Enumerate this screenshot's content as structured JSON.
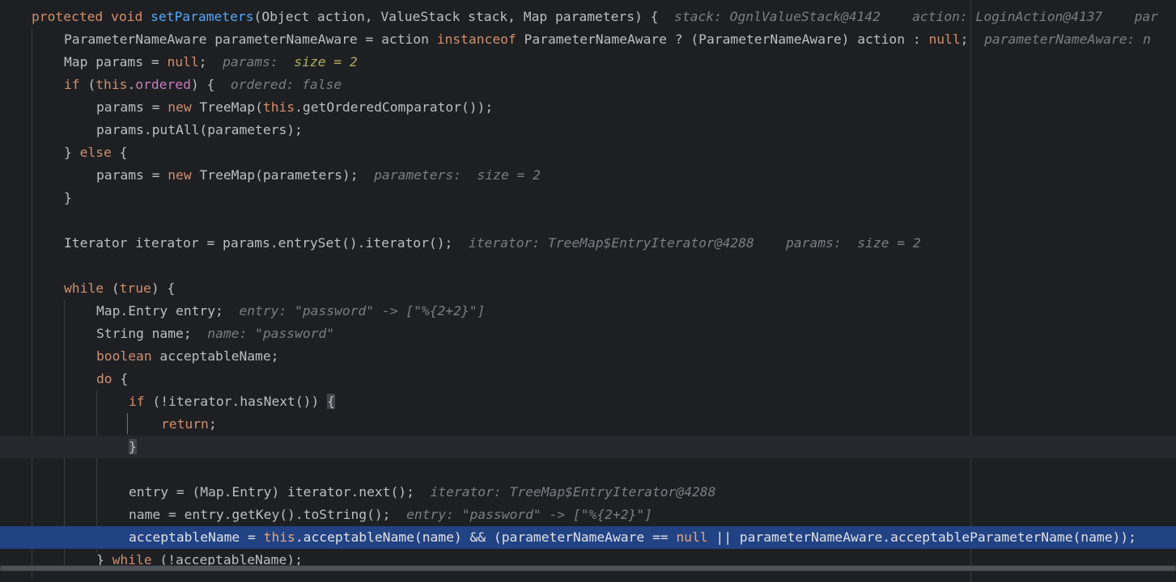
{
  "editor": {
    "lines": [
      [
        {
          "t": "protected",
          "c": "kw"
        },
        {
          "t": " "
        },
        {
          "t": "void",
          "c": "kw"
        },
        {
          "t": " "
        },
        {
          "t": "setParameters",
          "c": "fn"
        },
        {
          "t": "(Object action, ValueStack stack, Map parameters) {"
        },
        {
          "t": "  stack: OgnlValueStack@4142    action: LoginAction@4137    par",
          "c": "hint"
        }
      ],
      [
        {
          "t": "ParameterNameAware parameterNameAware = action "
        },
        {
          "t": "instanceof",
          "c": "kw"
        },
        {
          "t": " ParameterNameAware ? (ParameterNameAware) action : "
        },
        {
          "t": "null",
          "c": "kw"
        },
        {
          "t": ";"
        },
        {
          "t": "  parameterNameAware: n",
          "c": "hint"
        }
      ],
      [
        {
          "t": "Map params = "
        },
        {
          "t": "null",
          "c": "kw"
        },
        {
          "t": ";"
        },
        {
          "t": "  params:  ",
          "c": "hint"
        },
        {
          "t": "size = 2",
          "c": "hint-val"
        }
      ],
      [
        {
          "t": "if",
          "c": "kw"
        },
        {
          "t": " ("
        },
        {
          "t": "this",
          "c": "kw"
        },
        {
          "t": "."
        },
        {
          "t": "ordered",
          "c": "field"
        },
        {
          "t": ") {"
        },
        {
          "t": "  ordered: false",
          "c": "hint"
        }
      ],
      [
        {
          "t": "params = "
        },
        {
          "t": "new",
          "c": "kw"
        },
        {
          "t": " TreeMap("
        },
        {
          "t": "this",
          "c": "kw"
        },
        {
          "t": ".getOrderedComparator());"
        }
      ],
      [
        {
          "t": "params.putAll(parameters);"
        }
      ],
      [
        {
          "t": "} "
        },
        {
          "t": "else",
          "c": "kw"
        },
        {
          "t": " {"
        }
      ],
      [
        {
          "t": "params = "
        },
        {
          "t": "new",
          "c": "kw"
        },
        {
          "t": " TreeMap(parameters);"
        },
        {
          "t": "  parameters:  size = 2",
          "c": "hint"
        }
      ],
      [
        {
          "t": "}"
        }
      ],
      [],
      [
        {
          "t": "Iterator iterator = params.entrySet().iterator();"
        },
        {
          "t": "  iterator: TreeMap$EntryIterator@4288    params:  size = 2",
          "c": "hint"
        }
      ],
      [],
      [
        {
          "t": "while",
          "c": "kw"
        },
        {
          "t": " ("
        },
        {
          "t": "true",
          "c": "kw"
        },
        {
          "t": ") {"
        }
      ],
      [
        {
          "t": "Map.Entry entry;"
        },
        {
          "t": "  entry: \"password\" -> [\"%{2+2}\"]",
          "c": "hint"
        }
      ],
      [
        {
          "t": "String name;"
        },
        {
          "t": "  name: \"password\"",
          "c": "hint"
        }
      ],
      [
        {
          "t": "boolean",
          "c": "kw"
        },
        {
          "t": " acceptableName;"
        }
      ],
      [
        {
          "t": "do",
          "c": "kw"
        },
        {
          "t": " {"
        }
      ],
      [
        {
          "t": "if",
          "c": "kw"
        },
        {
          "t": " (!iterator.hasNext()) "
        },
        {
          "t": "{",
          "c": "brace-hl"
        }
      ],
      [
        {
          "t": "return",
          "c": "kw"
        },
        {
          "t": ";"
        }
      ],
      [
        {
          "t": "}",
          "c": "brace-hl"
        }
      ],
      [],
      [
        {
          "t": "entry = (Map.Entry) iterator.next();"
        },
        {
          "t": "  iterator: TreeMap$EntryIterator@4288",
          "c": "hint"
        }
      ],
      [
        {
          "t": "name = entry.getKey().toString();"
        },
        {
          "t": "  entry: \"password\" -> [\"%{2+2}\"]",
          "c": "hint"
        }
      ],
      [
        {
          "t": "acceptableName = "
        },
        {
          "t": "this",
          "c": "this"
        },
        {
          "t": ".acceptableName(name) && (parameterNameAware == "
        },
        {
          "t": "null",
          "c": "kw"
        },
        {
          "t": " || parameterNameAware.acceptableParameterName(name));"
        }
      ],
      [
        {
          "t": "} "
        },
        {
          "t": "while",
          "c": "kw"
        },
        {
          "t": " (!acceptableName);"
        }
      ]
    ]
  },
  "colors": {
    "background": "#1e1f22",
    "keyword": "#cf8e6d",
    "method": "#56a8f5",
    "field": "#c77dbb",
    "inline_hint": "#7a7e85",
    "execution_line": "#214283"
  }
}
